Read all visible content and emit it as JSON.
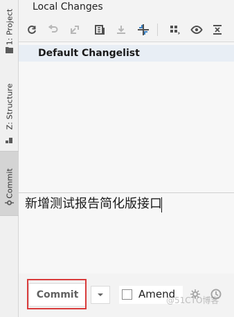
{
  "window": {
    "title": "Local Changes"
  },
  "sidebar": {
    "tabs": [
      {
        "label": "1: Project",
        "icon": "folder-icon",
        "active": false
      },
      {
        "label": "Z: Structure",
        "icon": "structure-icon",
        "active": false
      },
      {
        "label": "Commit",
        "icon": "commit-icon",
        "active": true
      }
    ]
  },
  "toolbar": {
    "buttons": [
      {
        "name": "refresh-icon"
      },
      {
        "name": "rollback-icon"
      },
      {
        "name": "move-icon"
      },
      {
        "name": "diff-icon"
      },
      {
        "name": "shelve-icon"
      },
      {
        "name": "update-icon"
      },
      {
        "name": "group-by-icon"
      },
      {
        "name": "view-options-icon"
      },
      {
        "name": "expand-all-icon"
      }
    ]
  },
  "changelist": {
    "default_name": "Default Changelist"
  },
  "commit_message": {
    "text": "新增测试报告简化版接口"
  },
  "commit_controls": {
    "commit_label": "Commit",
    "amend_label": "Amend",
    "watermark": "@51CTO博客"
  },
  "colors": {
    "highlight": "#d93b3b",
    "accent_blue": "#3b82c4"
  }
}
